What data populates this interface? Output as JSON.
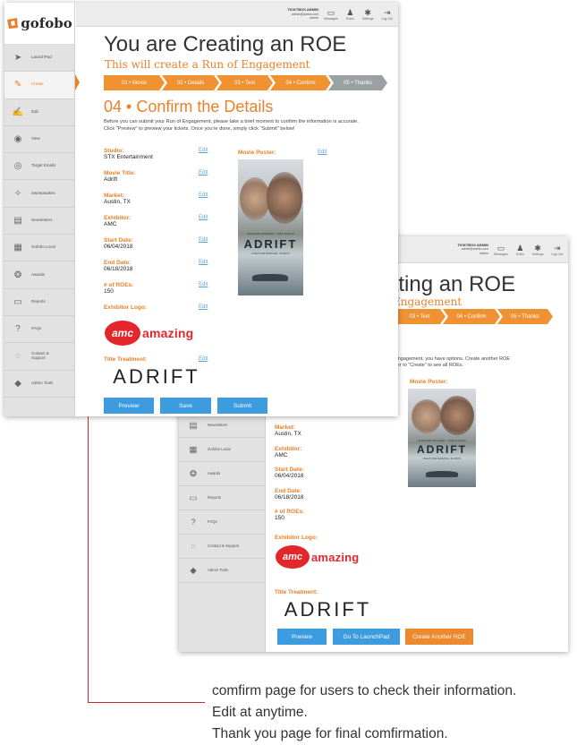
{
  "brand": {
    "logo_text": "gofobo",
    "primary": "#e8812a",
    "blue": "#3d9be0",
    "grey_step": "#9aa1a5",
    "red": "#c8282c"
  },
  "topbar": {
    "user_name": "TICKTBOX ADMIN",
    "user_email": "admin@admin.com",
    "user_role": "admin",
    "buttons": [
      {
        "label": "Messages",
        "icon": "inbox-icon"
      },
      {
        "label": "Roles",
        "icon": "users-icon"
      },
      {
        "label": "Settings",
        "icon": "gear-icon"
      },
      {
        "label": "Log Out",
        "icon": "logout-icon"
      }
    ]
  },
  "sidebar": {
    "items": [
      {
        "label": "LaunchPad",
        "icon": "paper-plane-icon"
      },
      {
        "label": "Create",
        "icon": "create-icon",
        "active": true
      },
      {
        "label": "Edit",
        "icon": "edit-icon"
      },
      {
        "label": "View",
        "icon": "eye-icon"
      },
      {
        "label": "Target Emails",
        "icon": "target-icon"
      },
      {
        "label": "Sweepstakes",
        "icon": "ticket-icon"
      },
      {
        "label": "Newsletters",
        "icon": "newsletter-icon"
      },
      {
        "label": "Gofobo Local",
        "icon": "local-icon"
      },
      {
        "label": "Awards",
        "icon": "award-icon"
      },
      {
        "label": "Reports",
        "icon": "reports-icon"
      },
      {
        "label": "FAQs",
        "icon": "question-icon"
      },
      {
        "label": "Contact & Support",
        "icon": "chat-icon"
      },
      {
        "label": "Admin Tools",
        "icon": "admin-tools-icon"
      }
    ]
  },
  "page": {
    "title": "You are Creating an ROE",
    "subtitle": "This will create a Run of Engagement",
    "steps": [
      "01 • Movie",
      "02 • Details",
      "03 • Text",
      "04 • Confirm",
      "05 • Thanks"
    ],
    "section_title": "04 • Confirm the Details",
    "intro": "Before you can submit your Run of Engagement, please take a brief moment to confirm the information is accurate. Click \"Preview\" to preview your tickets. Once you're done, simply click \"Submit\" below!",
    "edit_label": "Edit",
    "fields": [
      {
        "label": "Studio:",
        "value": "STX Entertainment"
      },
      {
        "label": "Movie Title:",
        "value": "Adrift"
      },
      {
        "label": "Market:",
        "value": "Austin, TX"
      },
      {
        "label": "Exhibitor:",
        "value": "AMC"
      },
      {
        "label": "Start Date:",
        "value": "06/04/2018"
      },
      {
        "label": "End Date:",
        "value": "06/18/2018"
      },
      {
        "label": "# of ROEs:",
        "value": "150"
      }
    ],
    "exhibitor_logo_label": "Exhibitor Logo:",
    "title_treatment_label": "Title Treatment:",
    "movie_poster_label": "Movie Poster:",
    "amc_badge": "amc",
    "amc_word": "amazing",
    "title_treatment": "ADRIFT",
    "poster_title": "ADRIFT",
    "poster_tagline": "FIGHT FOR SURVIVAL. 31 DAYS",
    "poster_cast_left": "SHAILENE WOODLEY",
    "poster_cast_right": "SAM CLAFLIN",
    "buttons": {
      "preview": "Preview",
      "save": "Save",
      "submit": "Submit"
    }
  },
  "thanks_page": {
    "title_fragment": "ating an ROE",
    "subtitle_fragment": "Engagement",
    "steps": [
      "03 • Text",
      "04 • Confirm",
      "05 • Thanks"
    ],
    "intro": "f Engagement, you have options. Create another ROE",
    "intro2": "over to \"Create\" to see all ROEs.",
    "buttons": {
      "preview": "Preview",
      "launchpad": "Go To LaunchPad",
      "another": "Create Another ROE"
    }
  },
  "annotation": {
    "lines": [
      "comfirm page for users to check their information.",
      "Edit at anytime.",
      "Thank you page for final comfirmation."
    ]
  }
}
